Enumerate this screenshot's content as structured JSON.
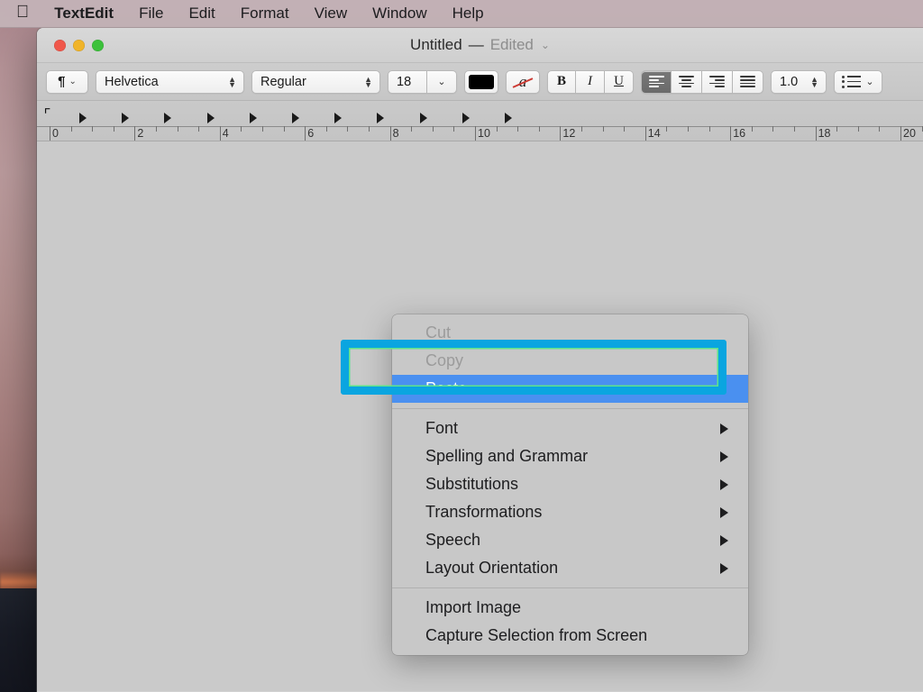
{
  "menubar": {
    "apple_icon": "apple-logo",
    "items": [
      {
        "label": "TextEdit",
        "bold": true
      },
      {
        "label": "File",
        "bold": false
      },
      {
        "label": "Edit",
        "bold": false
      },
      {
        "label": "Format",
        "bold": false
      },
      {
        "label": "View",
        "bold": false
      },
      {
        "label": "Window",
        "bold": false
      },
      {
        "label": "Help",
        "bold": false
      }
    ]
  },
  "window": {
    "title": "Untitled",
    "dash": "—",
    "edited": "Edited",
    "chevron": "⌄",
    "traffic_lights": {
      "close": "#f0574b",
      "minimize": "#f0b429",
      "zoom": "#3cc13b"
    }
  },
  "toolbar": {
    "paragraph_icon": "¶",
    "paragraph_chevron": "⌄",
    "font_name": "Helvetica",
    "font_style": "Regular",
    "font_size": "18",
    "size_chevron": "⌄",
    "text_color": "#000000",
    "text_color_icon": "strikethrough-a-icon",
    "bold": "B",
    "italic": "I",
    "underline": "U",
    "align_left": "align-left",
    "align_center": "align-center",
    "align_right": "align-right",
    "align_justify": "align-justify",
    "active_alignment": "align-left",
    "line_spacing": "1.0",
    "list_icon": "list-bullets-icon",
    "list_chevron": "⌄"
  },
  "ruler": {
    "numbers": [
      "0",
      "2",
      "4",
      "6",
      "8",
      "10",
      "12",
      "14",
      "16",
      "18",
      "20"
    ],
    "tab_markers": 11,
    "indent_icon": "first-line-indent-marker"
  },
  "context_menu": {
    "groups": [
      {
        "items": [
          {
            "label": "Cut",
            "state": "disabled",
            "submenu": false
          },
          {
            "label": "Copy",
            "state": "disabled",
            "submenu": false
          },
          {
            "label": "Paste",
            "state": "selected",
            "submenu": false
          }
        ]
      },
      {
        "items": [
          {
            "label": "Font",
            "state": "normal",
            "submenu": true
          },
          {
            "label": "Spelling and Grammar",
            "state": "normal",
            "submenu": true
          },
          {
            "label": "Substitutions",
            "state": "normal",
            "submenu": true
          },
          {
            "label": "Transformations",
            "state": "normal",
            "submenu": true
          },
          {
            "label": "Speech",
            "state": "normal",
            "submenu": true
          },
          {
            "label": "Layout Orientation",
            "state": "normal",
            "submenu": true
          }
        ]
      },
      {
        "items": [
          {
            "label": "Import Image",
            "state": "normal",
            "submenu": false
          },
          {
            "label": "Capture Selection from Screen",
            "state": "normal",
            "submenu": false
          }
        ]
      }
    ]
  },
  "annotation": {
    "target": "Paste",
    "border_color": "#0aa5e0",
    "inner_color": "#5de48a"
  },
  "colors": {
    "menubar_bg": "#c4b4b8",
    "window_bg": "#d2d2d2",
    "canvas_bg": "#cacaca",
    "menu_bg": "#c8c8c8",
    "selection_blue": "#4a90f0"
  }
}
